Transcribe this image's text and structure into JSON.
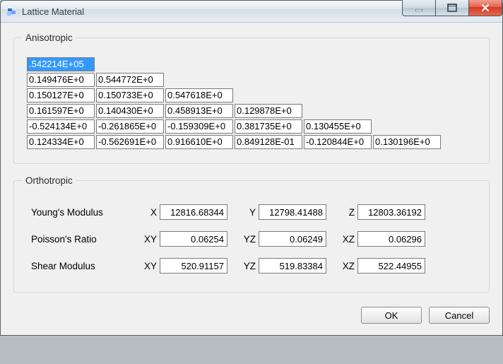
{
  "window": {
    "title": "Lattice Material",
    "ok_label": "OK",
    "cancel_label": "Cancel"
  },
  "anisotropic": {
    "legend": "Anisotropic",
    "matrix": [
      [
        ".542214E+05"
      ],
      [
        "0.149476E+0",
        "0.544772E+0"
      ],
      [
        "0.150127E+0",
        "0.150733E+0",
        "0.547618E+0"
      ],
      [
        "0.161597E+0",
        "0.140430E+0",
        "0.458913E+0",
        "0.129878E+0"
      ],
      [
        "-0.524134E+0",
        "-0.261865E+0",
        "-0.159309E+0",
        "0.381735E+0",
        "0.130455E+0"
      ],
      [
        "0.124334E+0",
        "-0.562691E+0",
        "0.916610E+0",
        "0.849128E-01",
        "-0.120844E+0",
        "0.130196E+0"
      ]
    ],
    "selected": {
      "row": 0,
      "col": 0
    }
  },
  "orthotropic": {
    "legend": "Orthotropic",
    "rows": [
      {
        "label": "Young's Modulus",
        "axes": [
          "X",
          "Y",
          "Z"
        ],
        "values": [
          "12816.68344",
          "12798.41488",
          "12803.36192"
        ]
      },
      {
        "label": "Poisson's Ratio",
        "axes": [
          "XY",
          "YZ",
          "XZ"
        ],
        "values": [
          "0.06254",
          "0.06249",
          "0.06296"
        ]
      },
      {
        "label": "Shear Modulus",
        "axes": [
          "XY",
          "YZ",
          "XZ"
        ],
        "values": [
          "520.91157",
          "519.83384",
          "522.44955"
        ]
      }
    ]
  }
}
